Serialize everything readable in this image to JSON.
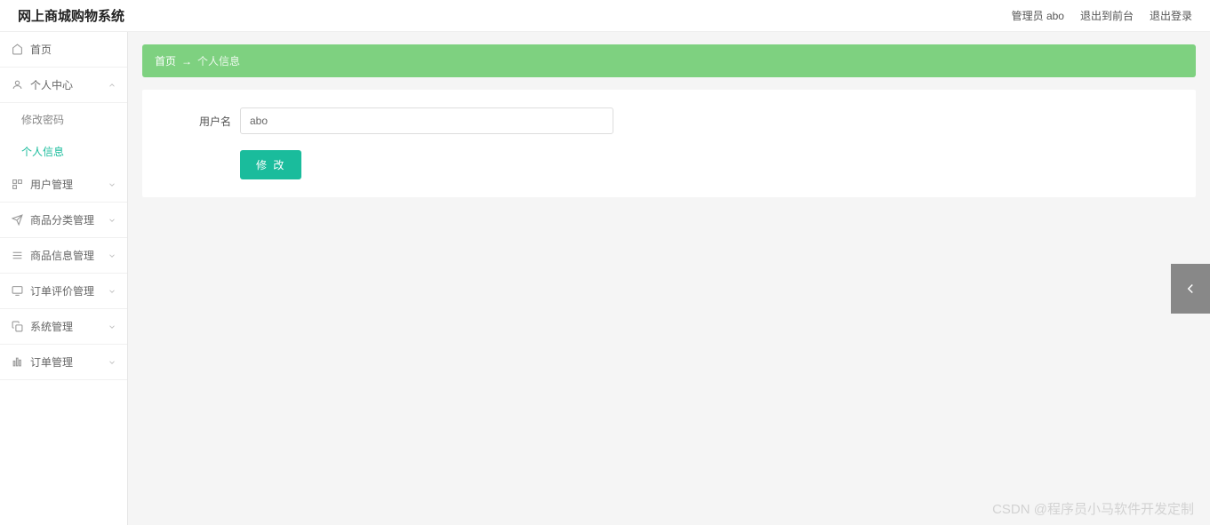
{
  "header": {
    "title": "网上商城购物系统",
    "admin_label": "管理员 abo",
    "front_link": "退出到前台",
    "logout_link": "退出登录"
  },
  "sidebar": {
    "items": [
      {
        "icon": "home",
        "label": "首页",
        "expandable": false
      },
      {
        "icon": "user",
        "label": "个人中心",
        "expandable": true,
        "expanded": true,
        "children": [
          {
            "label": "修改密码",
            "active": false
          },
          {
            "label": "个人信息",
            "active": true
          }
        ]
      },
      {
        "icon": "grid",
        "label": "用户管理",
        "expandable": true
      },
      {
        "icon": "plane",
        "label": "商品分类管理",
        "expandable": true
      },
      {
        "icon": "list",
        "label": "商品信息管理",
        "expandable": true
      },
      {
        "icon": "monitor",
        "label": "订单评价管理",
        "expandable": true
      },
      {
        "icon": "copy",
        "label": "系统管理",
        "expandable": true
      },
      {
        "icon": "bars",
        "label": "订单管理",
        "expandable": true
      }
    ]
  },
  "breadcrumb": {
    "home": "首页",
    "arrow": "→",
    "current": "个人信息"
  },
  "form": {
    "username_label": "用户名",
    "username_value": "abo",
    "submit_label": "修 改"
  },
  "watermark": "CSDN @程序员小马软件开发定制"
}
